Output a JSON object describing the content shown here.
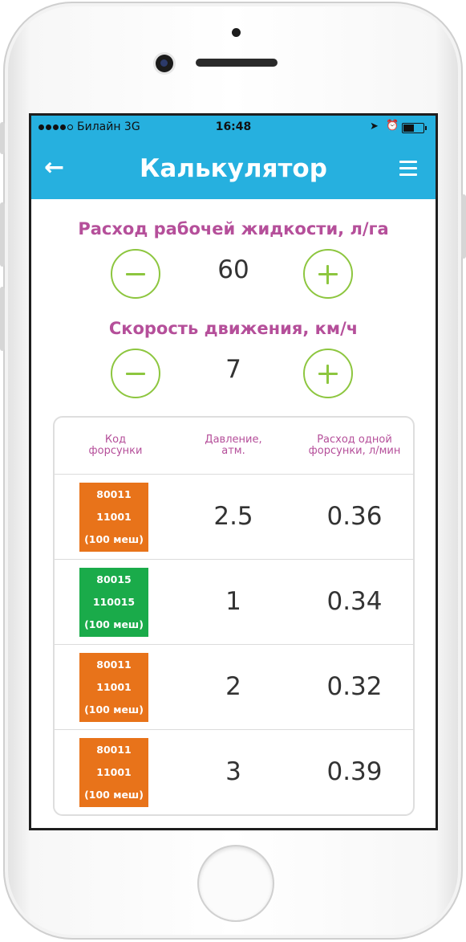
{
  "status_bar": {
    "carrier": "Билайн  3G",
    "time": "16:48",
    "location_icon": "location-arrow-icon",
    "alarm_icon": "alarm-icon",
    "battery_icon": "battery-icon"
  },
  "header": {
    "title": "Калькулятор",
    "back_icon": "arrow-left-icon",
    "menu_icon": "hamburger-menu-icon"
  },
  "flow_rate": {
    "label": "Расход рабочей жидкости, л/га",
    "value": "60"
  },
  "speed": {
    "label": "Скорость движения, км/ч",
    "value": "7"
  },
  "table": {
    "headers": {
      "code": [
        "Код",
        "форсунки"
      ],
      "pressure": [
        "Давление,",
        "атм."
      ],
      "rate": [
        "Расход одной",
        "форсунки, л/мин"
      ]
    },
    "rows": [
      {
        "code1": "80011",
        "code2": "11001",
        "mesh": "(100 меш)",
        "color": "#e8731a",
        "pressure": "2.5",
        "rate": "0.36"
      },
      {
        "code1": "80015",
        "code2": "110015",
        "mesh": "(100 меш)",
        "color": "#1aab4a",
        "pressure": "1",
        "rate": "0.34"
      },
      {
        "code1": "80011",
        "code2": "11001",
        "mesh": "(100 меш)",
        "color": "#e8731a",
        "pressure": "2",
        "rate": "0.32"
      },
      {
        "code1": "80011",
        "code2": "11001",
        "mesh": "(100 меш)",
        "color": "#e8731a",
        "pressure": "3",
        "rate": "0.39"
      }
    ]
  },
  "colors": {
    "accent": "#26b0df",
    "label": "#b54f9a",
    "button": "#8dc63f"
  }
}
